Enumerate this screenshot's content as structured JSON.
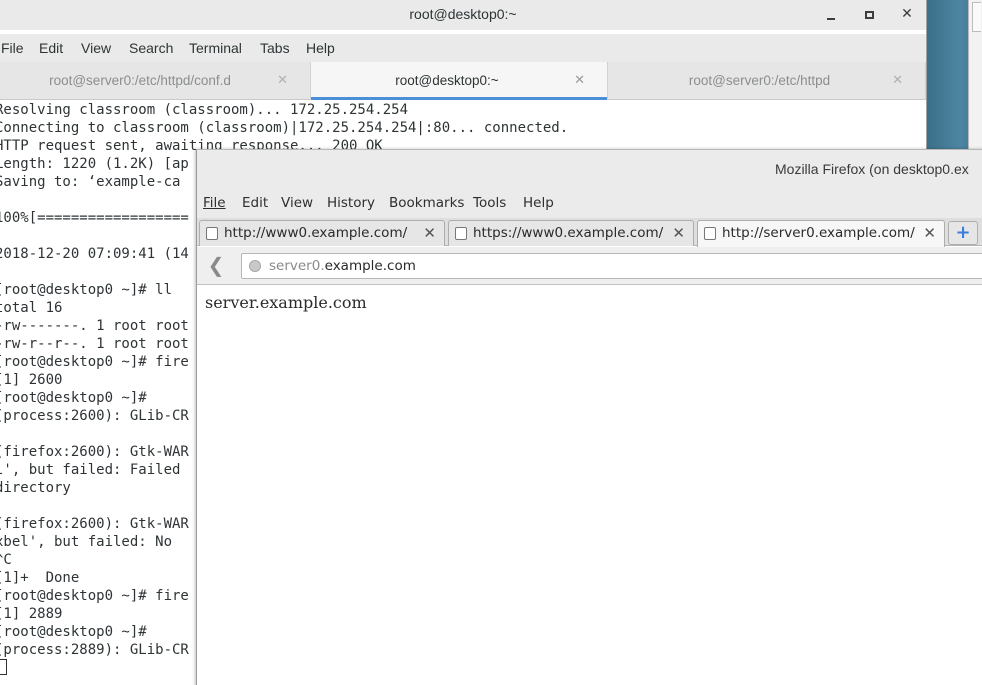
{
  "terminal": {
    "title": "root@desktop0:~",
    "menu": [
      "File",
      "Edit",
      "View",
      "Search",
      "Terminal",
      "Tabs",
      "Help"
    ],
    "tabs": [
      {
        "label": "root@server0:/etc/httpd/conf.d",
        "active": false
      },
      {
        "label": "root@desktop0:~",
        "active": true
      },
      {
        "label": "root@server0:/etc/httpd",
        "active": false
      }
    ],
    "lines": [
      "Resolving classroom (classroom)... 172.25.254.254",
      "Connecting to classroom (classroom)|172.25.254.254|:80... connected.",
      "HTTP request sent, awaiting response... 200 OK",
      "Length: 1220 (1.2K) [ap",
      "Saving to: ‘example-ca",
      "",
      "100%[==================",
      "",
      "2018-12-20 07:09:41 (14",
      "",
      "[root@desktop0 ~]# ll",
      "total 16",
      "-rw-------. 1 root root",
      "-rw-r--r--. 1 root root",
      "[root@desktop0 ~]# fire",
      "[1] 2600",
      "[root@desktop0 ~]#",
      "(process:2600): GLib-CR",
      "",
      "(firefox:2600): Gtk-WAR",
      "l', but failed: Failed",
      "directory",
      "",
      "(firefox:2600): Gtk-WAR",
      "xbel', but failed: No",
      "^C",
      "[1]+  Done",
      "[root@desktop0 ~]# fire",
      "[1] 2889",
      "[root@desktop0 ~]#",
      "(process:2889): GLib-CR",
      ""
    ]
  },
  "firefox": {
    "title": "Mozilla Firefox (on desktop0.ex",
    "menu": [
      "File",
      "Edit",
      "View",
      "History",
      "Bookmarks",
      "Tools",
      "Help"
    ],
    "tabs": [
      {
        "label": "http://www0.example.com/",
        "active": false
      },
      {
        "label": "https://www0.example.com/",
        "active": false
      },
      {
        "label": "http://server0.example.com/",
        "active": true
      }
    ],
    "new_tab_label": "+",
    "url_prefix": "server0.",
    "url_domain": "example.com",
    "page_text": "server.example.com"
  }
}
